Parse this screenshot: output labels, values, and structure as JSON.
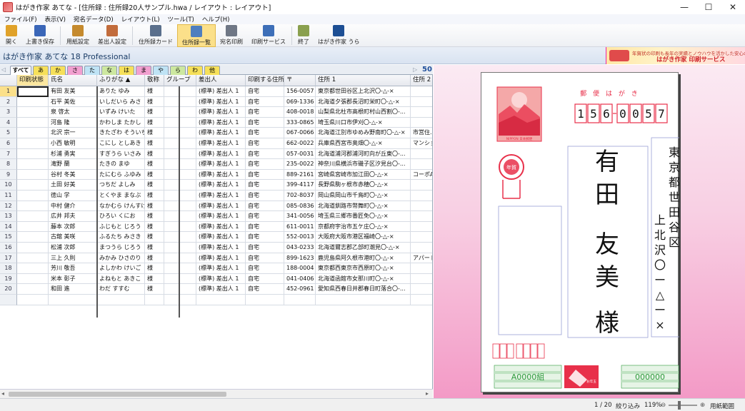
{
  "window": {
    "title": "はがき作家 あてな - [住所録 : 住所録20人サンプル.hwa / レイアウト : レイアウト]",
    "controls": [
      "—",
      "☐",
      "✕"
    ]
  },
  "menu": [
    "ファイル(F)",
    "表示(V)",
    "宛名データ(D)",
    "レイアウト(L)",
    "ツール(T)",
    "ヘルプ(H)"
  ],
  "toolbar": [
    {
      "label": "開く",
      "icon": "folder-icon",
      "color": "#e0a22a"
    },
    {
      "label": "上書き保存",
      "icon": "save-icon",
      "color": "#3a66b8"
    },
    {
      "label": "用紙設定",
      "icon": "paper-setup-icon",
      "color": "#c58a2e"
    },
    {
      "label": "差出人設定",
      "icon": "sender-icon",
      "color": "#c26c3c"
    },
    {
      "label": "住所録カード",
      "icon": "address-card-icon",
      "color": "#5a6f8c"
    },
    {
      "label": "住所録一覧",
      "icon": "address-list-icon",
      "color": "#4f7fbf"
    },
    {
      "label": "宛名印刷",
      "icon": "print-icon",
      "color": "#6f7785"
    },
    {
      "label": "印刷サービス",
      "icon": "print-service-icon",
      "color": "#3d6fb8"
    },
    {
      "label": "終了",
      "icon": "exit-icon",
      "color": "#8aa04f"
    },
    {
      "label": "はがき作家 うら",
      "icon": "hagaki-ura-icon",
      "color": "#1d4f94"
    }
  ],
  "app": {
    "name": "はがき作家 あてな 18 Professional",
    "banner_small": "年賀状の印刷も長年の実績とノウハウを活かした安心の品質",
    "banner_big": "はがき作家 印刷サービス"
  },
  "index_tabs": {
    "items": [
      {
        "label": "すべて",
        "color": "#ffffff"
      },
      {
        "label": "あ",
        "color": "#f6e05a"
      },
      {
        "label": "か",
        "color": "#f6e05a"
      },
      {
        "label": "さ",
        "color": "#f2a0d0"
      },
      {
        "label": "た",
        "color": "#bfe3f5"
      },
      {
        "label": "な",
        "color": "#cde8a0"
      },
      {
        "label": "は",
        "color": "#f6e05a"
      },
      {
        "label": "ま",
        "color": "#f2a0d0"
      },
      {
        "label": "や",
        "color": "#bfe3f5"
      },
      {
        "label": "ら",
        "color": "#cde8a0"
      },
      {
        "label": "わ",
        "color": "#f6e05a"
      },
      {
        "label": "他",
        "color": "#f6e05a"
      }
    ],
    "count": "50"
  },
  "grid": {
    "columns": [
      "",
      "印刷状態",
      "氏名",
      "ふりがな ▲",
      "敬称",
      "グループ",
      "差出人",
      "印刷する住所",
      "〒",
      "住所 1",
      "住所 2"
    ],
    "rows": [
      [
        "1",
        "",
        "有田 友美",
        "ありた ゆみ",
        "様",
        "",
        "(標準) 差出人 1",
        "自宅",
        "156-0057",
        "東京都世田谷区上北沢〇-△-×",
        ""
      ],
      [
        "2",
        "",
        "石平 美佐",
        "いしだいら みさ",
        "様",
        "",
        "(標準) 差出人 1",
        "自宅",
        "069-1336",
        "北海道夕張郡長沼町栄町〇-△-×",
        ""
      ],
      [
        "3",
        "",
        "泉 啓太",
        "いずみ けいた",
        "様",
        "",
        "(標準) 差出人 1",
        "自宅",
        "408-0018",
        "山梨県北杜市高根町村山西割〇-...",
        ""
      ],
      [
        "4",
        "",
        "河島 隆",
        "かわしま たかし",
        "様",
        "",
        "(標準) 差出人 1",
        "自宅",
        "333-0865",
        "埼玉県川口市伊刈〇-△-×",
        ""
      ],
      [
        "5",
        "",
        "北沢 宗一",
        "きたざわ そういち",
        "様",
        "",
        "(標準) 差出人 1",
        "自宅",
        "067-0066",
        "北海道江別市ゆめみ野南町〇-△-×",
        "市営住..."
      ],
      [
        "6",
        "",
        "小西 敏明",
        "こにし としあき",
        "様",
        "",
        "(標準) 差出人 1",
        "自宅",
        "662-0022",
        "兵庫県西宮市奥畑〇-△-×",
        "マンション"
      ],
      [
        "7",
        "",
        "杉浦 勇実",
        "すぎうら いさみ",
        "様",
        "",
        "(標準) 差出人 1",
        "自宅",
        "057-0031",
        "北海道浦河郡浦河町向が丘東〇-...",
        ""
      ],
      [
        "8",
        "",
        "滝野 蘭",
        "たきの まゆ",
        "様",
        "",
        "(標準) 差出人 1",
        "自宅",
        "235-0022",
        "神奈川県横浜市磯子区汐見台〇-...",
        ""
      ],
      [
        "9",
        "",
        "谷村 冬美",
        "たにむら ふゆみ",
        "様",
        "",
        "(標準) 差出人 1",
        "自宅",
        "889-2161",
        "宮崎県宮崎市加江田〇-△-×",
        "コーポAB"
      ],
      [
        "10",
        "",
        "土田 好美",
        "つちだ よしみ",
        "様",
        "",
        "(標準) 差出人 1",
        "自宅",
        "399-4117",
        "長野県駒ヶ根市赤穂〇-△-×",
        ""
      ],
      [
        "11",
        "",
        "徳山 学",
        "とくやま まなぶ",
        "様",
        "",
        "(標準) 差出人 1",
        "自宅",
        "702-8037",
        "岡山県岡山市千鳥町〇-△-×",
        ""
      ],
      [
        "12",
        "",
        "中村 健介",
        "なかむら けんすけ",
        "様",
        "",
        "(標準) 差出人 1",
        "自宅",
        "085-0836",
        "北海道釧路市幣舞町〇-△-×",
        ""
      ],
      [
        "13",
        "",
        "広井 邦夫",
        "ひろい くにお",
        "様",
        "",
        "(標準) 差出人 1",
        "自宅",
        "341-0056",
        "埼玉県三郷市番匠免〇-△-×",
        ""
      ],
      [
        "14",
        "",
        "藤本 次郎",
        "ふじもと じろう",
        "様",
        "",
        "(標準) 差出人 1",
        "自宅",
        "611-0011",
        "京都府宇治市五ケ庄〇-△-×",
        ""
      ],
      [
        "15",
        "",
        "古舘 美咲",
        "ふるたち みさき",
        "様",
        "",
        "(標準) 差出人 1",
        "自宅",
        "552-0013",
        "大阪府大阪市港区福崎〇-△-×",
        ""
      ],
      [
        "16",
        "",
        "松浦 次郎",
        "まつうら じろう",
        "様",
        "",
        "(標準) 差出人 1",
        "自宅",
        "043-0233",
        "北海道爾志郡乙部町潮見〇-△-×",
        ""
      ],
      [
        "17",
        "",
        "三上 久則",
        "みかみ ひさのり",
        "様",
        "",
        "(標準) 差出人 1",
        "自宅",
        "899-1623",
        "鹿児島県阿久根市港町〇-△-×",
        "アパートA"
      ],
      [
        "18",
        "",
        "芳川 敬吾",
        "よしかわ けいご",
        "様",
        "",
        "(標準) 差出人 1",
        "自宅",
        "188-0004",
        "東京都西東京市西原町〇-△-×",
        ""
      ],
      [
        "19",
        "",
        "米本 彰子",
        "よねもと あきこ",
        "様",
        "",
        "(標準) 差出人 1",
        "自宅",
        "041-0406",
        "北海道函館市女那川町〇-△-×",
        ""
      ],
      [
        "20",
        "",
        "和田 進",
        "わだ すすむ",
        "様",
        "",
        "(標準) 差出人 1",
        "自宅",
        "452-0961",
        "愛知県西春日井郡春日町落合〇-...",
        ""
      ]
    ]
  },
  "postcard": {
    "header": "郵 便 は が き",
    "postal_digits": [
      "1",
      "5",
      "6",
      "0",
      "0",
      "5",
      "7"
    ],
    "name_chars": [
      "有",
      "田",
      "友",
      "美",
      "様"
    ],
    "address_col1": [
      "東",
      "京",
      "都",
      "世",
      "田",
      "谷",
      "区"
    ],
    "address_col2": [
      "上",
      "北",
      "沢",
      "〇",
      "ー",
      "△",
      "ー",
      "×"
    ],
    "stamp_caption": "NIPPON 日本郵便",
    "nenga": "年賀",
    "lottery_left": "A0000組",
    "lottery_right": "000000",
    "lottery_center": "お年玉"
  },
  "status": {
    "page": "1 / 20",
    "filter": "絞り込み",
    "zoom": "119%",
    "fit": "用紙範囲"
  },
  "colors": {
    "accent": "#fbe08a",
    "postcard_red": "#e8304a",
    "lottery_green": "#2e9a3c"
  }
}
